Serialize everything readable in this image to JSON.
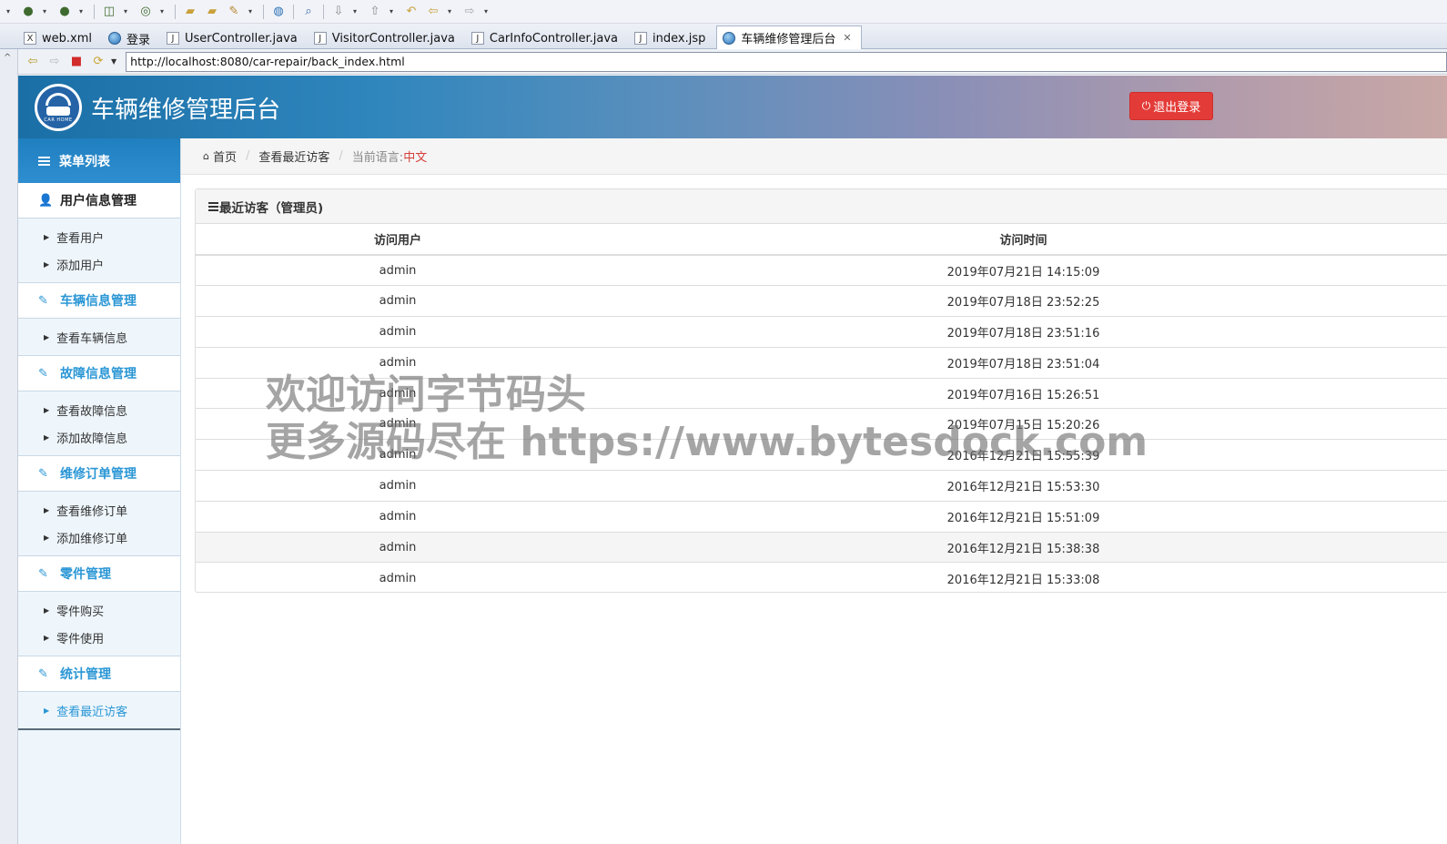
{
  "ide": {
    "tabs": [
      {
        "label": "web.xml",
        "icon": "xml-file-icon"
      },
      {
        "label": "登录",
        "icon": "globe-icon"
      },
      {
        "label": "UserController.java",
        "icon": "java-file-icon"
      },
      {
        "label": "VisitorController.java",
        "icon": "java-file-icon"
      },
      {
        "label": "CarInfoController.java",
        "icon": "java-file-icon"
      },
      {
        "label": "index.jsp",
        "icon": "jsp-file-icon"
      },
      {
        "label": "车辆维修管理后台",
        "icon": "globe-icon",
        "active": true
      }
    ],
    "url": "http://localhost:8080/car-repair/back_index.html"
  },
  "header": {
    "logo_text": "CAR HOME",
    "title": "车辆维修管理后台",
    "logout_label": "退出登录"
  },
  "sidebar": {
    "menu_title": "菜单列表",
    "groups": [
      {
        "title": "用户信息管理",
        "items": [
          "查看用户",
          "添加用户"
        ]
      },
      {
        "title": "车辆信息管理",
        "items": [
          "查看车辆信息"
        ]
      },
      {
        "title": "故障信息管理",
        "items": [
          "查看故障信息",
          "添加故障信息"
        ]
      },
      {
        "title": "维修订单管理",
        "items": [
          "查看维修订单",
          "添加维修订单"
        ]
      },
      {
        "title": "零件管理",
        "items": [
          "零件购买",
          "零件使用"
        ]
      },
      {
        "title": "统计管理",
        "items": [
          "查看最近访客"
        ]
      }
    ]
  },
  "breadcrumb": {
    "home": "首页",
    "current": "查看最近访客",
    "lang_label": "当前语言:",
    "lang_value": "中文"
  },
  "panel": {
    "title": "最近访客（管理员)",
    "columns": [
      "访问用户",
      "访问时间"
    ],
    "rows": [
      [
        "admin",
        "2019年07月21日 14:15:09"
      ],
      [
        "admin",
        "2019年07月18日 23:52:25"
      ],
      [
        "admin",
        "2019年07月18日 23:51:16"
      ],
      [
        "admin",
        "2019年07月18日 23:51:04"
      ],
      [
        "admin",
        "2019年07月16日 15:26:51"
      ],
      [
        "admin",
        "2019年07月15日 15:20:26"
      ],
      [
        "admin",
        "2016年12月21日 15:55:39"
      ],
      [
        "admin",
        "2016年12月21日 15:53:30"
      ],
      [
        "admin",
        "2016年12月21日 15:51:09"
      ],
      [
        "admin",
        "2016年12月21日 15:38:38"
      ],
      [
        "admin",
        "2016年12月21日 15:33:08"
      ]
    ]
  },
  "watermark": {
    "line1": "欢迎访问字节码头",
    "line2": "更多源码尽在 https://www.bytesdock.com"
  }
}
